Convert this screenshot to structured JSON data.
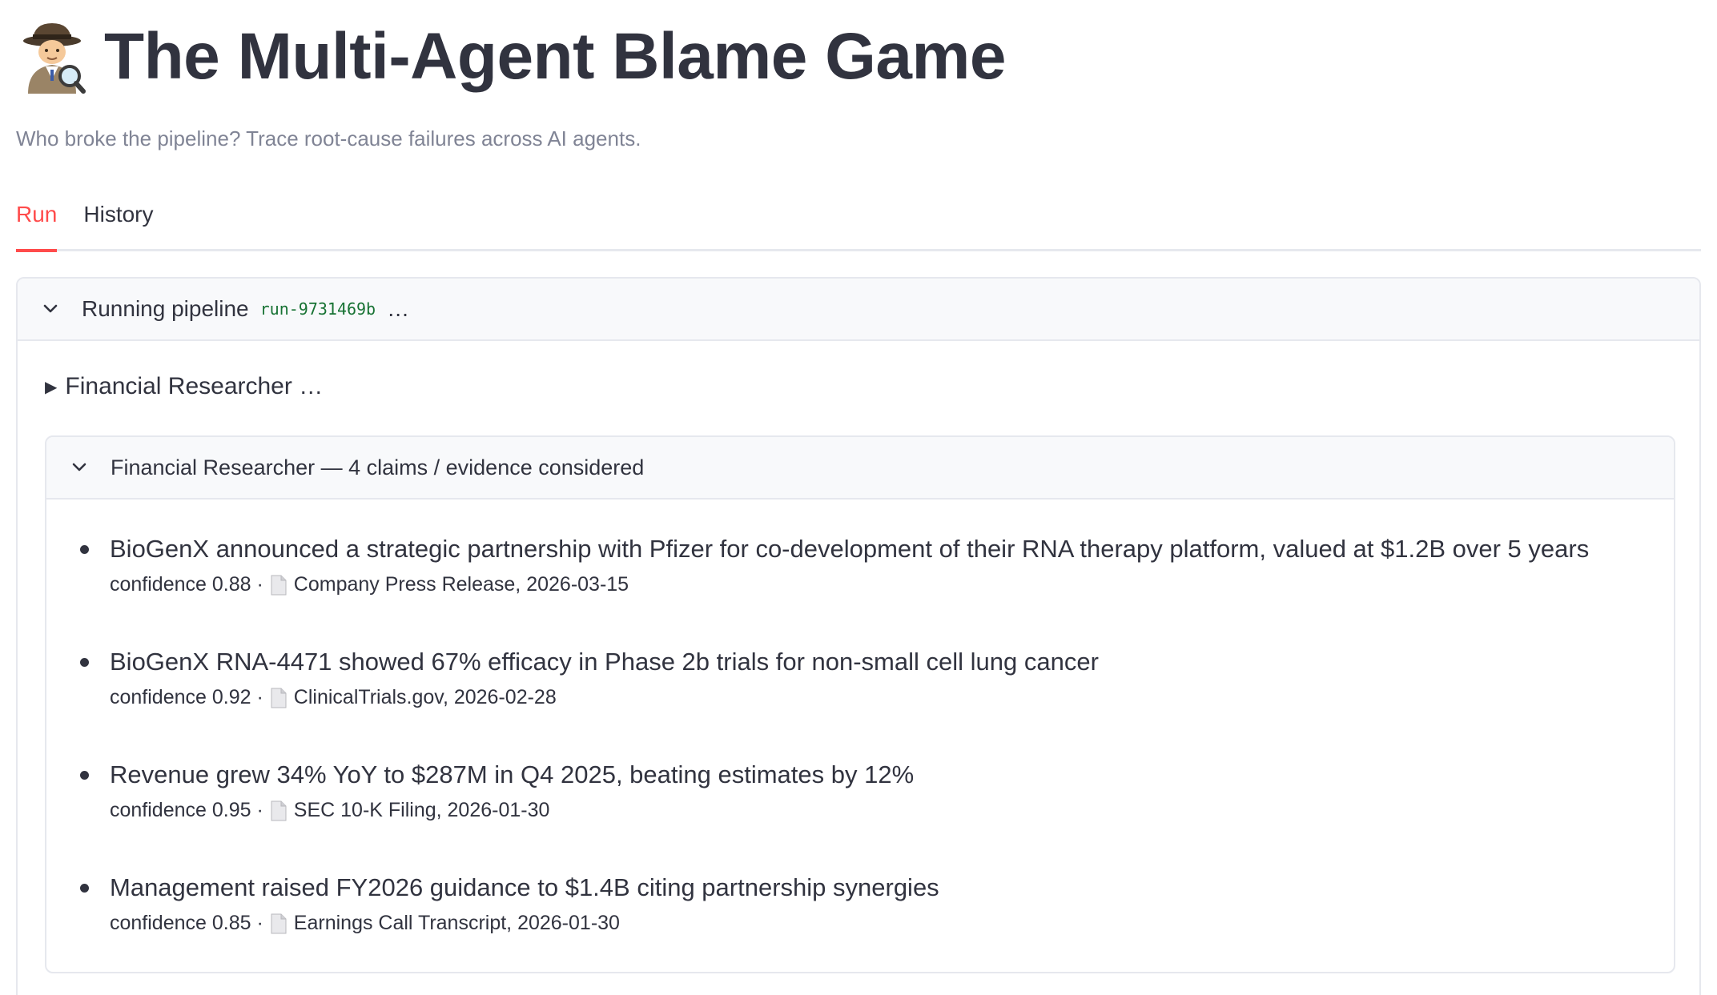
{
  "header": {
    "icon": "detective-icon",
    "title": "The Multi-Agent Blame Game",
    "subtitle": "Who broke the pipeline? Trace root-cause failures across AI agents."
  },
  "tabs": [
    {
      "label": "Run",
      "active": true
    },
    {
      "label": "History",
      "active": false
    }
  ],
  "pipeline": {
    "label": "Running pipeline",
    "run_id": "run-9731469b",
    "ellipsis": "…",
    "status_text": "Financial Researcher …",
    "agent_expander": {
      "label": "Financial Researcher — 4 claims / evidence considered",
      "claims": [
        {
          "text": "BioGenX announced a strategic partnership with Pfizer for co-development of their RNA therapy platform, valued at $1.2B over 5 years",
          "confidence": "confidence 0.88 ·",
          "source": "Company Press Release, 2026-03-15"
        },
        {
          "text": "BioGenX RNA-4471 showed 67% efficacy in Phase 2b trials for non-small cell lung cancer",
          "confidence": "confidence 0.92 ·",
          "source": "ClinicalTrials.gov, 2026-02-28"
        },
        {
          "text": "Revenue grew 34% YoY to $287M in Q4 2025, beating estimates by 12%",
          "confidence": "confidence 0.95 ·",
          "source": "SEC 10-K Filing, 2026-01-30"
        },
        {
          "text": "Management raised FY2026 guidance to $1.4B citing partnership synergies",
          "confidence": "confidence 0.85 ·",
          "source": "Earnings Call Transcript, 2026-01-30"
        }
      ]
    }
  },
  "colors": {
    "accent": "#ff4b4b",
    "code_green": "#177233",
    "text": "#31333f",
    "muted": "#808495"
  }
}
